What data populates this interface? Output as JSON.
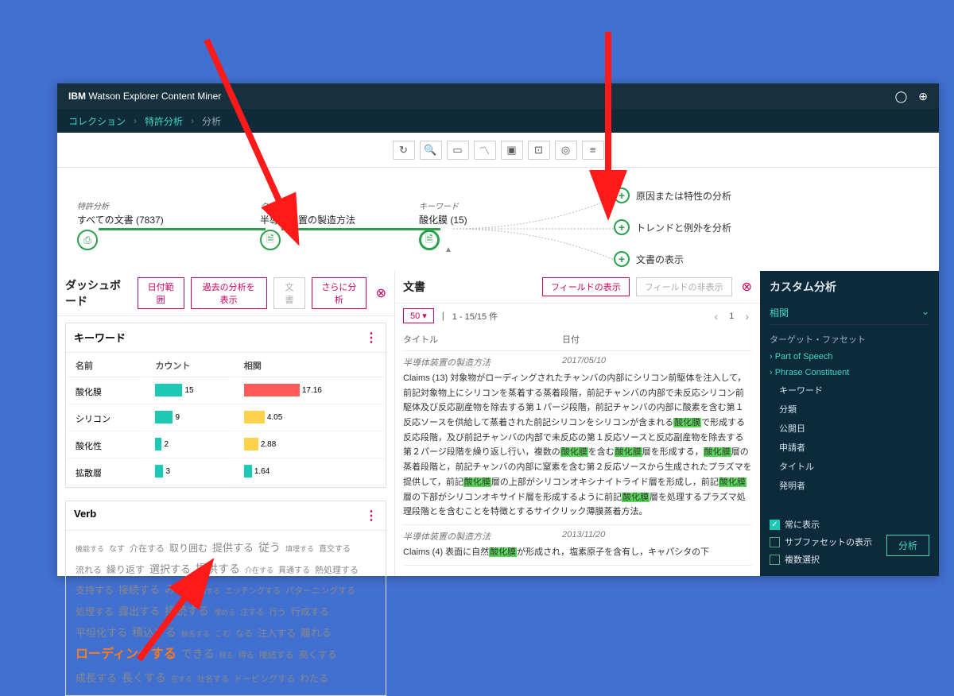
{
  "product": {
    "brand": "IBM",
    "name": "Watson Explorer Content Miner"
  },
  "breadcrumb": {
    "a": "コレクション",
    "b": "特許分析",
    "c": "分析"
  },
  "path": {
    "node1": {
      "label": "特許分析",
      "value": "すべての文書 (7837)"
    },
    "node2": {
      "label": "タイトル",
      "value": "半導体装置の製造方法"
    },
    "node3": {
      "label": "キーワード",
      "value": "酸化膜 (15)"
    },
    "branch1": "原因または特性の分析",
    "branch2": "トレンドと例外を分析",
    "branch3": "文書の表示"
  },
  "dashboard": {
    "title": "ダッシュボード",
    "btn_date": "日付範囲",
    "btn_past": "過去の分析を表示",
    "btn_doc": "文書",
    "btn_more": "さらに分析",
    "keyword_card": {
      "title": "キーワード",
      "col_name": "名前",
      "col_count": "カウント",
      "col_corr": "相関",
      "rows": [
        {
          "name": "酸化膜",
          "count": 15,
          "cfill": 34,
          "corr": "17.16",
          "rfill": 70,
          "rtype": "r"
        },
        {
          "name": "シリコン",
          "count": 9,
          "cfill": 22,
          "corr": "4.05",
          "rfill": 26,
          "rtype": "y"
        },
        {
          "name": "酸化性",
          "count": 2,
          "cfill": 8,
          "corr": "2.88",
          "rfill": 18,
          "rtype": "y"
        },
        {
          "name": "拡散層",
          "count": 3,
          "cfill": 10,
          "corr": "1.64",
          "rfill": 10,
          "rtype": ""
        }
      ]
    },
    "verb_card": {
      "title": "Verb",
      "highlight": "ローディングする",
      "words": [
        "機能する",
        "なす",
        "介在する",
        "取り囲む",
        "提供する",
        "従う",
        "填埋する",
        "直交する",
        "流れる",
        "繰り返す",
        "選択する",
        "提供する",
        "介在する",
        "貫通する",
        "熱処理する",
        "支持する",
        "接続する",
        "みる",
        "供給する",
        "エッチングする",
        "パターニングする",
        "処理する",
        "露出する",
        "接続する",
        "埋める",
        "注する",
        "行う",
        "行成する",
        "平坦化する",
        "積込する",
        "除去する",
        "こむ",
        "なる",
        "注入する",
        "離れる",
        "できる",
        "残る",
        "得る",
        "接続する",
        "高くする",
        "成長する",
        "長くする",
        "在する",
        "杜名する",
        "ドーピングする",
        "わたる"
      ]
    }
  },
  "docs": {
    "title": "文書",
    "btn_show": "フィールドの表示",
    "btn_hide": "フィールドの非表示",
    "page_size": "50",
    "range": "1 - 15/15 件",
    "page": "1",
    "col_title": "タイトル",
    "col_date": "日付",
    "rows": [
      {
        "title": "半導体装置の製造方法",
        "date": "2017/05/10",
        "snippet_html": "Claims (13) 対象物がローディングされたチャンバの内部にシリコン前駆体を注入して，前記対象物上にシリコンを蒸着する蒸着段階，前記チャンバの内部で未反応シリコン前駆体及び反応副産物を除去する第１パージ段階，前記チャンバの内部に酸素を含む第１反応ソースを供給して蒸着された前記シリコンをシリコンが含まれる<span class='hl'>酸化膜</span>で形成する反応段階，及び前記チャンバの内部で未反応の第１反応ソースと反応副産物を除去する第２パージ段階を繰り返し行い，複数の<span class='hl'>酸化膜</span>を含む<span class='hl'>酸化膜</span>層を形成する，<span class='hl'>酸化膜</span>層の蒸着段階と，前記チャンバの内部に窒素を含む第２反応ソースから生成されたプラズマを提供して，前記<span class='hl'>酸化膜</span>層の上部がシリコンオキシナイトライド層を形成し，前記<span class='hl'>酸化膜</span>層の下部がシリコンオキサイド層を形成するように前記<span class='hl'>酸化膜</span>層を処理するプラズマ処理段階とを含むことを特徴とするサイクリック薄膜蒸着方法。"
      },
      {
        "title": "半導体装置の製造方法",
        "date": "2013/11/20",
        "snippet_html": "Claims (4) 表面に自然<span class='hl'>酸化膜</span>が形成され，塩素原子を含有し，キャパシタの下"
      }
    ]
  },
  "side": {
    "title": "カスタム分析",
    "selected": "相関",
    "facet_label": "ターゲット・ファセット",
    "parents": [
      "Part of Speech",
      "Phrase Constituent"
    ],
    "items": [
      "キーワード",
      "分類",
      "公開日",
      "申請者",
      "タイトル",
      "発明者"
    ],
    "opt1": "常に表示",
    "opt2": "サブファセットの表示",
    "opt3": "複数選択",
    "analyze": "分析"
  }
}
